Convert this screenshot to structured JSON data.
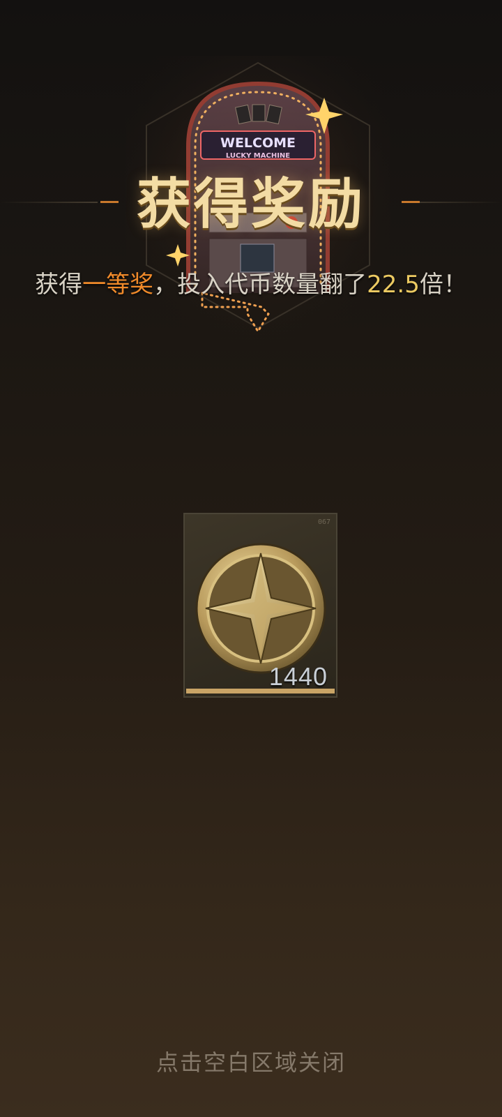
{
  "header": {
    "title": "获得奖励",
    "sign_line1": "WELCOME",
    "sign_line2": "LUCKY MACHINE"
  },
  "message": {
    "prefix": "获得",
    "prize": "一等奖",
    "middle": "，投入代币数量翻了",
    "multiplier": "22.5",
    "suffix": "倍！"
  },
  "reward": {
    "icon": "gold-cross-coin-icon",
    "count": "1440",
    "corner_tag": "067"
  },
  "footer": {
    "close_hint": "点击空白区域关闭"
  },
  "colors": {
    "title": "#f3dca4",
    "prize_accent": "#f08a2a",
    "multiplier_accent": "#ecca62",
    "rarity_bar": "#c9a466"
  }
}
